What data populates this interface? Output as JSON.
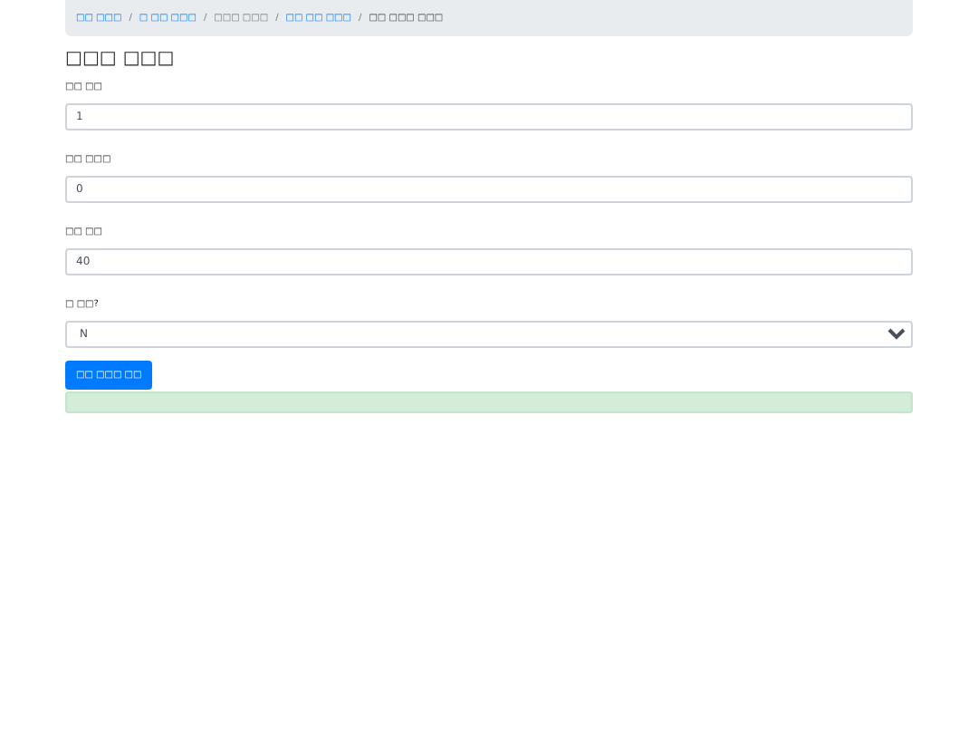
{
  "breadcrumb_separators": [
    "/",
    "/",
    "/",
    "/"
  ],
  "breadcrumb": [
    {
      "label": "□□ □□□",
      "kind": "link"
    },
    {
      "label": "□ □□ □□□",
      "kind": "link"
    },
    {
      "label": "□□□ □□□",
      "kind": "text"
    },
    {
      "label": "□□ □□ □□□",
      "kind": "link"
    },
    {
      "label": "□□ □□□ □□□",
      "kind": "active"
    }
  ],
  "title": "□□□ □□□",
  "fields": [
    {
      "label": "□□ □□",
      "kind": "input",
      "value": "1"
    },
    {
      "label": "□□ □□□",
      "kind": "input",
      "value": "0"
    },
    {
      "label": "□□ □□",
      "kind": "input",
      "value": "40"
    },
    {
      "label": "□ □□?",
      "kind": "select",
      "value": "N"
    }
  ],
  "submit": "□□ □□□ □□",
  "alert": {
    "kind": "success"
  }
}
